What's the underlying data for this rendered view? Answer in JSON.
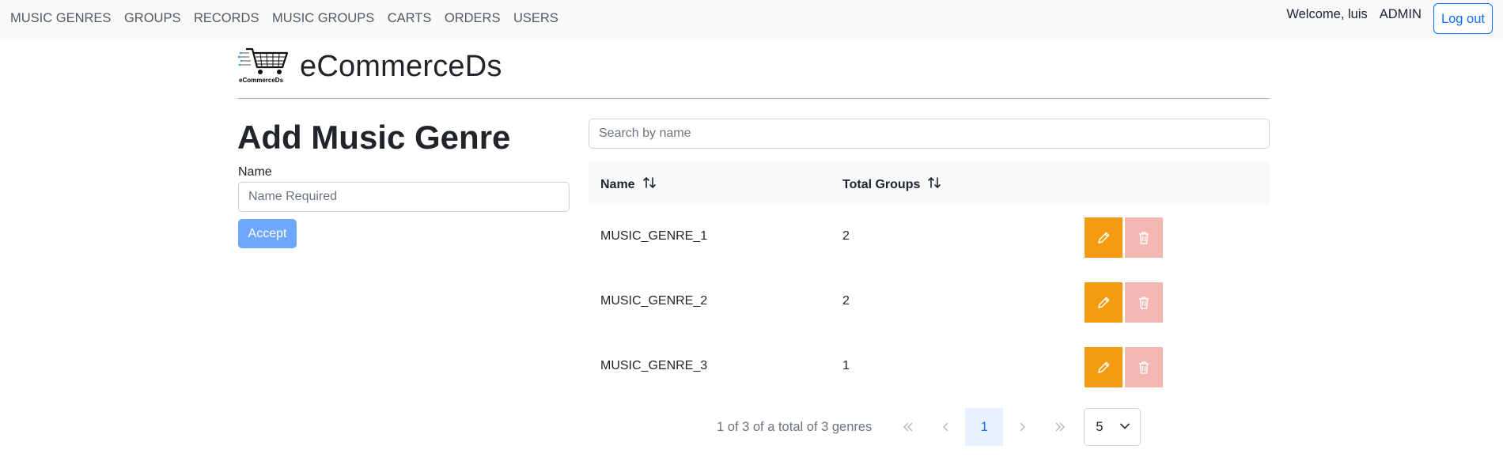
{
  "navbar": {
    "links": [
      "MUSIC GENRES",
      "GROUPS",
      "RECORDS",
      "MUSIC GROUPS",
      "CARTS",
      "ORDERS",
      "USERS"
    ],
    "welcome": "Welcome, luis",
    "role": "ADMIN",
    "logout_label": "Log out"
  },
  "brand": {
    "logo_text": "eCommerceDs",
    "name": "eCommerceDs"
  },
  "form": {
    "title": "Add Music Genre",
    "name_label": "Name",
    "name_placeholder": "Name Required",
    "name_value": "",
    "accept_label": "Accept"
  },
  "search": {
    "placeholder": "Search by name",
    "value": ""
  },
  "table": {
    "headers": [
      "Name",
      "Total Groups"
    ],
    "rows": [
      {
        "name": "MUSIC_GENRE_1",
        "total": "2"
      },
      {
        "name": "MUSIC_GENRE_2",
        "total": "2"
      },
      {
        "name": "MUSIC_GENRE_3",
        "total": "1"
      }
    ]
  },
  "pagination": {
    "info": "1 of 3 of a total of 3 genres",
    "first": "«",
    "prev": "‹",
    "current": "1",
    "next": "›",
    "last": "»",
    "page_size": "5"
  },
  "colors": {
    "edit": "#f39c12",
    "delete": "#f5b7b1",
    "accept": "#6ea8fe",
    "primary": "#0d6efd"
  }
}
